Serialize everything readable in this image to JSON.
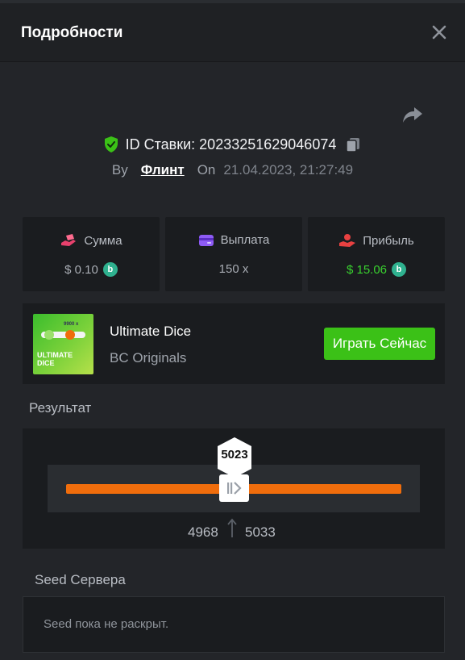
{
  "header": {
    "title": "Подробности"
  },
  "bet": {
    "id_text": "ID Ставки: 20233251629046074",
    "by_label": "By",
    "user": "Флинт",
    "on_label": "On",
    "datetime": "21.04.2023, 21:27:49"
  },
  "stats": [
    {
      "label": "Сумма",
      "value": "$ 0.10",
      "icon": "money-hand-icon"
    },
    {
      "label": "Выплата",
      "value": "150 x",
      "icon": "wallet-icon"
    },
    {
      "label": "Прибыль",
      "value": "$ 15.06",
      "icon": "profit-hand-icon"
    }
  ],
  "game": {
    "name": "Ultimate Dice",
    "provider": "BC Originals",
    "play_label": "Играть Сейчас",
    "thumb_text": "ULTIMATE DICE",
    "thumb_badge": "9900 x"
  },
  "result": {
    "label": "Результат",
    "value": "5023",
    "range_low": "4968",
    "range_high": "5033"
  },
  "seed": {
    "label": "Seed Сервера",
    "text": "Seed пока не раскрыт."
  },
  "colors": {
    "accent_green": "#3bc117",
    "profit_green": "#39d12f",
    "track_orange": "#f06d0c",
    "coin_teal": "#2fb18f"
  }
}
